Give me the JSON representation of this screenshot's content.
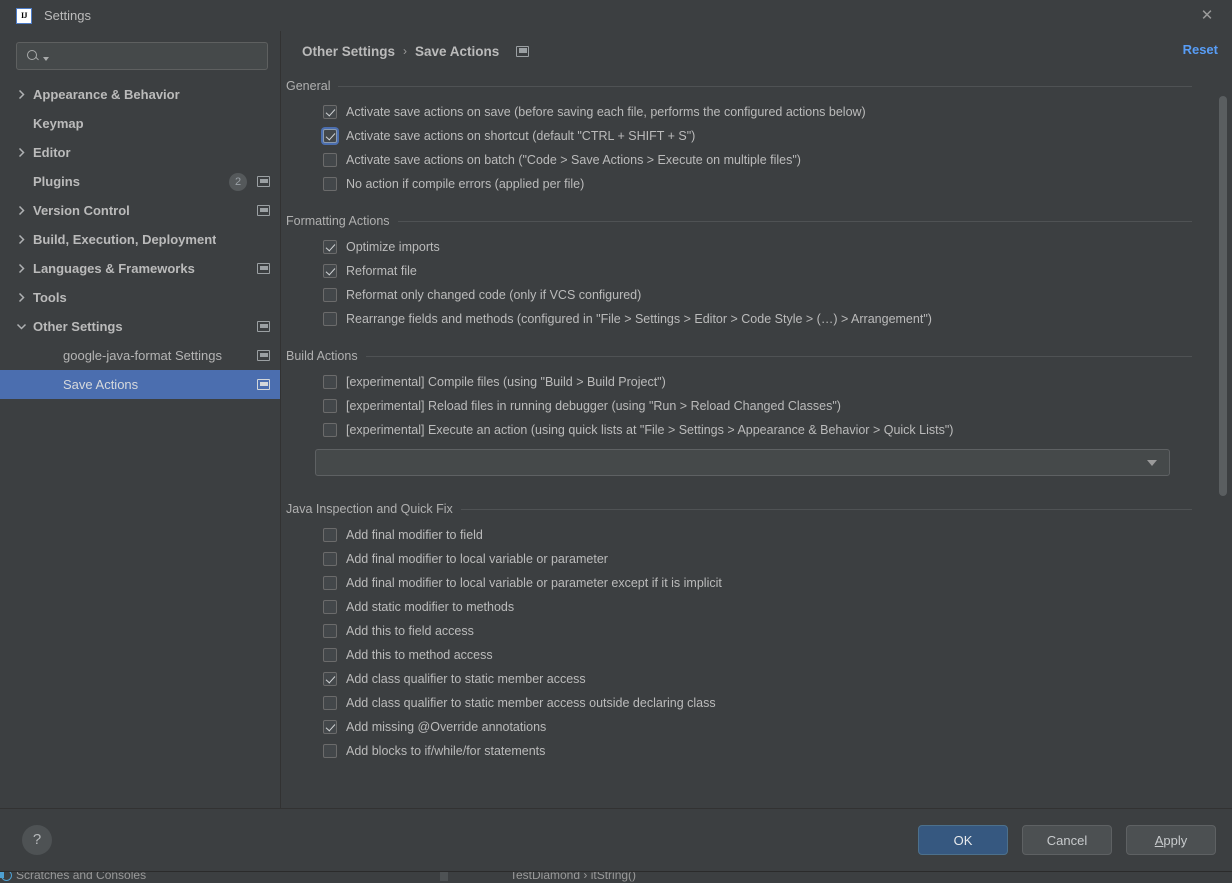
{
  "window": {
    "title": "Settings",
    "logo_text": "IJ",
    "close_label": "✕"
  },
  "background_ide": {
    "left_status": "Scratches and Consoles",
    "right_status": "TestDiamond  ›  itString()"
  },
  "sidebar": {
    "search": {
      "placeholder": "",
      "value": ""
    },
    "items": [
      {
        "label": "Appearance & Behavior",
        "arrow": "collapsed",
        "indent": "root",
        "badge": null,
        "monitor": false,
        "selected": false
      },
      {
        "label": "Keymap",
        "arrow": "none",
        "indent": "root",
        "badge": null,
        "monitor": false,
        "selected": false
      },
      {
        "label": "Editor",
        "arrow": "collapsed",
        "indent": "root",
        "badge": null,
        "monitor": false,
        "selected": false
      },
      {
        "label": "Plugins",
        "arrow": "none",
        "indent": "root",
        "badge": "2",
        "monitor": true,
        "selected": false
      },
      {
        "label": "Version Control",
        "arrow": "collapsed",
        "indent": "root",
        "badge": null,
        "monitor": true,
        "selected": false
      },
      {
        "label": "Build, Execution, Deployment",
        "arrow": "collapsed",
        "indent": "root",
        "badge": null,
        "monitor": false,
        "selected": false
      },
      {
        "label": "Languages & Frameworks",
        "arrow": "collapsed",
        "indent": "root",
        "badge": null,
        "monitor": true,
        "selected": false
      },
      {
        "label": "Tools",
        "arrow": "collapsed",
        "indent": "root",
        "badge": null,
        "monitor": false,
        "selected": false
      },
      {
        "label": "Other Settings",
        "arrow": "expanded",
        "indent": "root",
        "badge": null,
        "monitor": true,
        "selected": false
      },
      {
        "label": "google-java-format Settings",
        "arrow": "none",
        "indent": "child",
        "badge": null,
        "monitor": true,
        "selected": false
      },
      {
        "label": "Save Actions",
        "arrow": "none",
        "indent": "child",
        "badge": null,
        "monitor": true,
        "selected": true
      }
    ]
  },
  "header": {
    "breadcrumb_parent": "Other Settings",
    "breadcrumb_separator": "›",
    "breadcrumb_current": "Save Actions",
    "reset_label": "Reset"
  },
  "sections": [
    {
      "title": "General",
      "options": [
        {
          "label": "Activate save actions on save (before saving each file, performs the configured actions below)",
          "checked": true,
          "focused": false
        },
        {
          "label": "Activate save actions on shortcut (default \"CTRL + SHIFT + S\")",
          "checked": true,
          "focused": true
        },
        {
          "label": "Activate save actions on batch (\"Code > Save Actions > Execute on multiple files\")",
          "checked": false,
          "focused": false
        },
        {
          "label": "No action if compile errors (applied per file)",
          "checked": false,
          "focused": false
        }
      ]
    },
    {
      "title": "Formatting Actions",
      "options": [
        {
          "label": "Optimize imports",
          "checked": true,
          "focused": false
        },
        {
          "label": "Reformat file",
          "checked": true,
          "focused": false
        },
        {
          "label": "Reformat only changed code (only if VCS configured)",
          "checked": false,
          "focused": false
        },
        {
          "label": "Rearrange fields and methods (configured in \"File > Settings > Editor > Code Style > (…) > Arrangement\")",
          "checked": false,
          "focused": false
        }
      ]
    },
    {
      "title": "Build Actions",
      "options": [
        {
          "label": "[experimental] Compile files (using \"Build > Build Project\")",
          "checked": false,
          "focused": false
        },
        {
          "label": "[experimental] Reload files in running debugger (using \"Run > Reload Changed Classes\")",
          "checked": false,
          "focused": false
        },
        {
          "label": "[experimental] Execute an action (using quick lists at \"File > Settings > Appearance & Behavior > Quick Lists\")",
          "checked": false,
          "focused": false
        }
      ],
      "combo": {
        "value": ""
      }
    },
    {
      "title": "Java Inspection and Quick Fix",
      "options": [
        {
          "label": "Add final modifier to field",
          "checked": false,
          "focused": false
        },
        {
          "label": "Add final modifier to local variable or parameter",
          "checked": false,
          "focused": false
        },
        {
          "label": "Add final modifier to local variable or parameter except if it is implicit",
          "checked": false,
          "focused": false
        },
        {
          "label": "Add static modifier to methods",
          "checked": false,
          "focused": false
        },
        {
          "label": "Add this to field access",
          "checked": false,
          "focused": false
        },
        {
          "label": "Add this to method access",
          "checked": false,
          "focused": false
        },
        {
          "label": "Add class qualifier to static member access",
          "checked": true,
          "focused": false
        },
        {
          "label": "Add class qualifier to static member access outside declaring class",
          "checked": false,
          "focused": false
        },
        {
          "label": "Add missing @Override annotations",
          "checked": true,
          "focused": false
        },
        {
          "label": "Add blocks to if/while/for statements",
          "checked": false,
          "focused": false
        }
      ]
    }
  ],
  "footer": {
    "help_label": "?",
    "ok_label": "OK",
    "cancel_label": "Cancel",
    "apply_label": "Apply",
    "apply_mnemonic": "A",
    "apply_rest": "pply"
  },
  "colors": {
    "dialog_bg": "#3c3f41",
    "selection_blue": "#4b6eaf",
    "link_blue": "#589df6",
    "primary_button": "#365880",
    "text": "#bbbbbb"
  }
}
